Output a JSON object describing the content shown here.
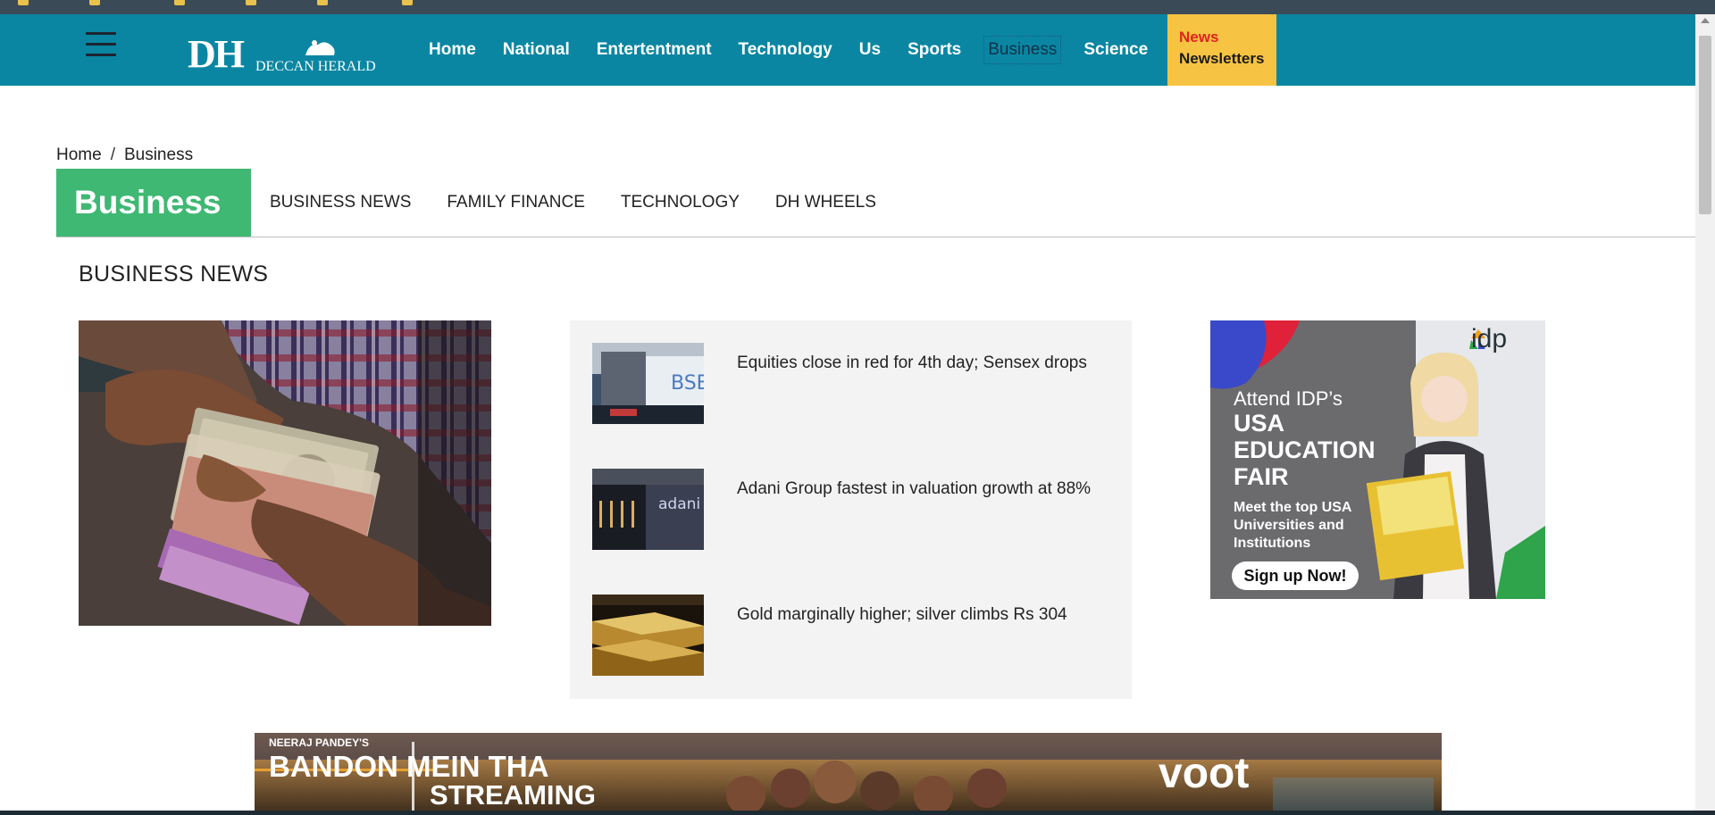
{
  "logo": {
    "initials": "DH",
    "name": "DECCAN HERALD"
  },
  "main_nav": [
    "Home",
    "National",
    "Entertentment",
    "Technology",
    "Us",
    "Sports",
    "Business",
    "Science"
  ],
  "newsletter": {
    "line1": "News",
    "line2": "Newsletters"
  },
  "breadcrumb": {
    "home": "Home",
    "separator": "/",
    "current": "Business"
  },
  "section": {
    "title": "Business"
  },
  "sub_nav": [
    "BUSINESS NEWS",
    "FAMILY FINANCE",
    "TECHNOLOGY",
    "DH WHEELS"
  ],
  "news_heading": "BUSINESS NEWS",
  "news": [
    {
      "title": "Equities close in red for 4th day; Sensex drops"
    },
    {
      "title": "Adani Group fastest in valuation growth at 88%"
    },
    {
      "title": "Gold marginally higher; silver climbs Rs 304"
    }
  ],
  "ad_idp": {
    "line1": "Attend IDP’s",
    "line2": "USA EDUCATION FAIR",
    "line3": "Meet the top USA Universities and Institutions",
    "cta": "Sign up Now!",
    "brand": "idp"
  },
  "ad_voot": {
    "small": "NEERAJ PANDEY'S",
    "title": "BANDON MEIN THA",
    "streaming": "STREAMING",
    "brand": "voot"
  },
  "colors": {
    "header": "#0a86a2",
    "section": "#3fb873",
    "newsletter": "#f7c342"
  }
}
